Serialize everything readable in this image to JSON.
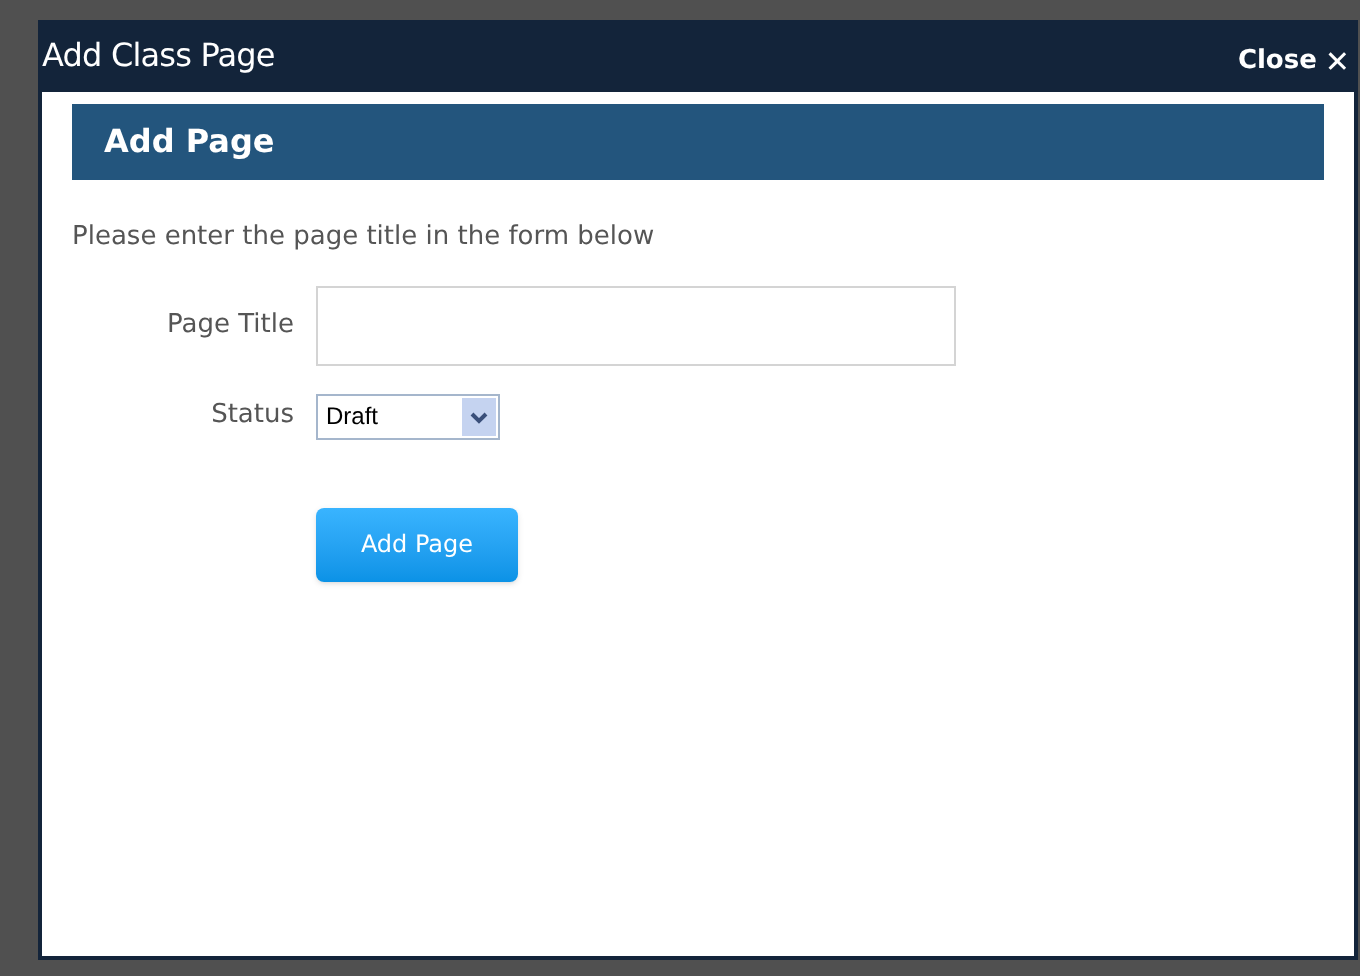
{
  "dialog": {
    "title": "Add Class Page",
    "close_label": "Close",
    "close_glyph": "✕",
    "header": "Add Page",
    "instruction": "Please enter the page title in the form below",
    "fields": [
      {
        "kind": "text",
        "label": "Page Title"
      },
      {
        "kind": "select",
        "label": "Status",
        "value": "Draft"
      }
    ],
    "submit": "Add Page"
  }
}
